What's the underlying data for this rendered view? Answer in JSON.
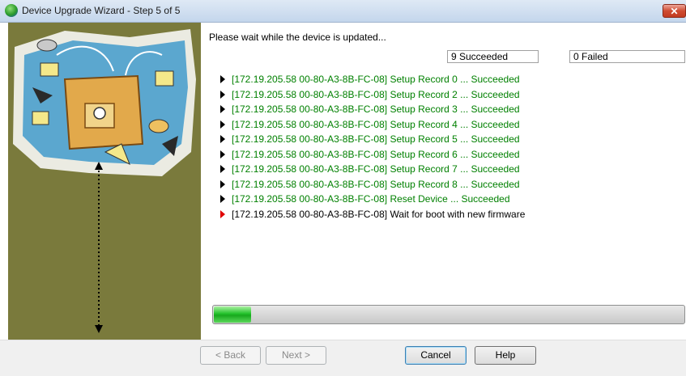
{
  "window": {
    "title": "Device Upgrade Wizard - Step 5 of 5",
    "close_label": "✕"
  },
  "main": {
    "instruction": "Please wait while the device is updated...",
    "succeeded_count": "9 Succeeded",
    "failed_count": "0 Failed",
    "progress_fraction": 0.08,
    "log": [
      {
        "text": "[172.19.205.58 00-80-A3-8B-FC-08] Setup Record 0 ... Succeeded",
        "status": "ok"
      },
      {
        "text": "[172.19.205.58 00-80-A3-8B-FC-08] Setup Record 2 ... Succeeded",
        "status": "ok"
      },
      {
        "text": "[172.19.205.58 00-80-A3-8B-FC-08] Setup Record 3 ... Succeeded",
        "status": "ok"
      },
      {
        "text": "[172.19.205.58 00-80-A3-8B-FC-08] Setup Record 4 ... Succeeded",
        "status": "ok"
      },
      {
        "text": "[172.19.205.58 00-80-A3-8B-FC-08] Setup Record 5 ... Succeeded",
        "status": "ok"
      },
      {
        "text": "[172.19.205.58 00-80-A3-8B-FC-08] Setup Record 6 ... Succeeded",
        "status": "ok"
      },
      {
        "text": "[172.19.205.58 00-80-A3-8B-FC-08] Setup Record 7 ... Succeeded",
        "status": "ok"
      },
      {
        "text": "[172.19.205.58 00-80-A3-8B-FC-08] Setup Record 8 ... Succeeded",
        "status": "ok"
      },
      {
        "text": "[172.19.205.58 00-80-A3-8B-FC-08] Reset Device ... Succeeded",
        "status": "ok"
      },
      {
        "text": "[172.19.205.58 00-80-A3-8B-FC-08] Wait for boot with new firmware",
        "status": "pending"
      }
    ]
  },
  "footer": {
    "back_label": "< Back",
    "next_label": "Next >",
    "cancel_label": "Cancel",
    "help_label": "Help"
  },
  "colors": {
    "success_text": "#008000",
    "active_marker": "#e00000",
    "sidebar_bg": "#7a7a3c",
    "progress_fill": "#22c22a"
  }
}
